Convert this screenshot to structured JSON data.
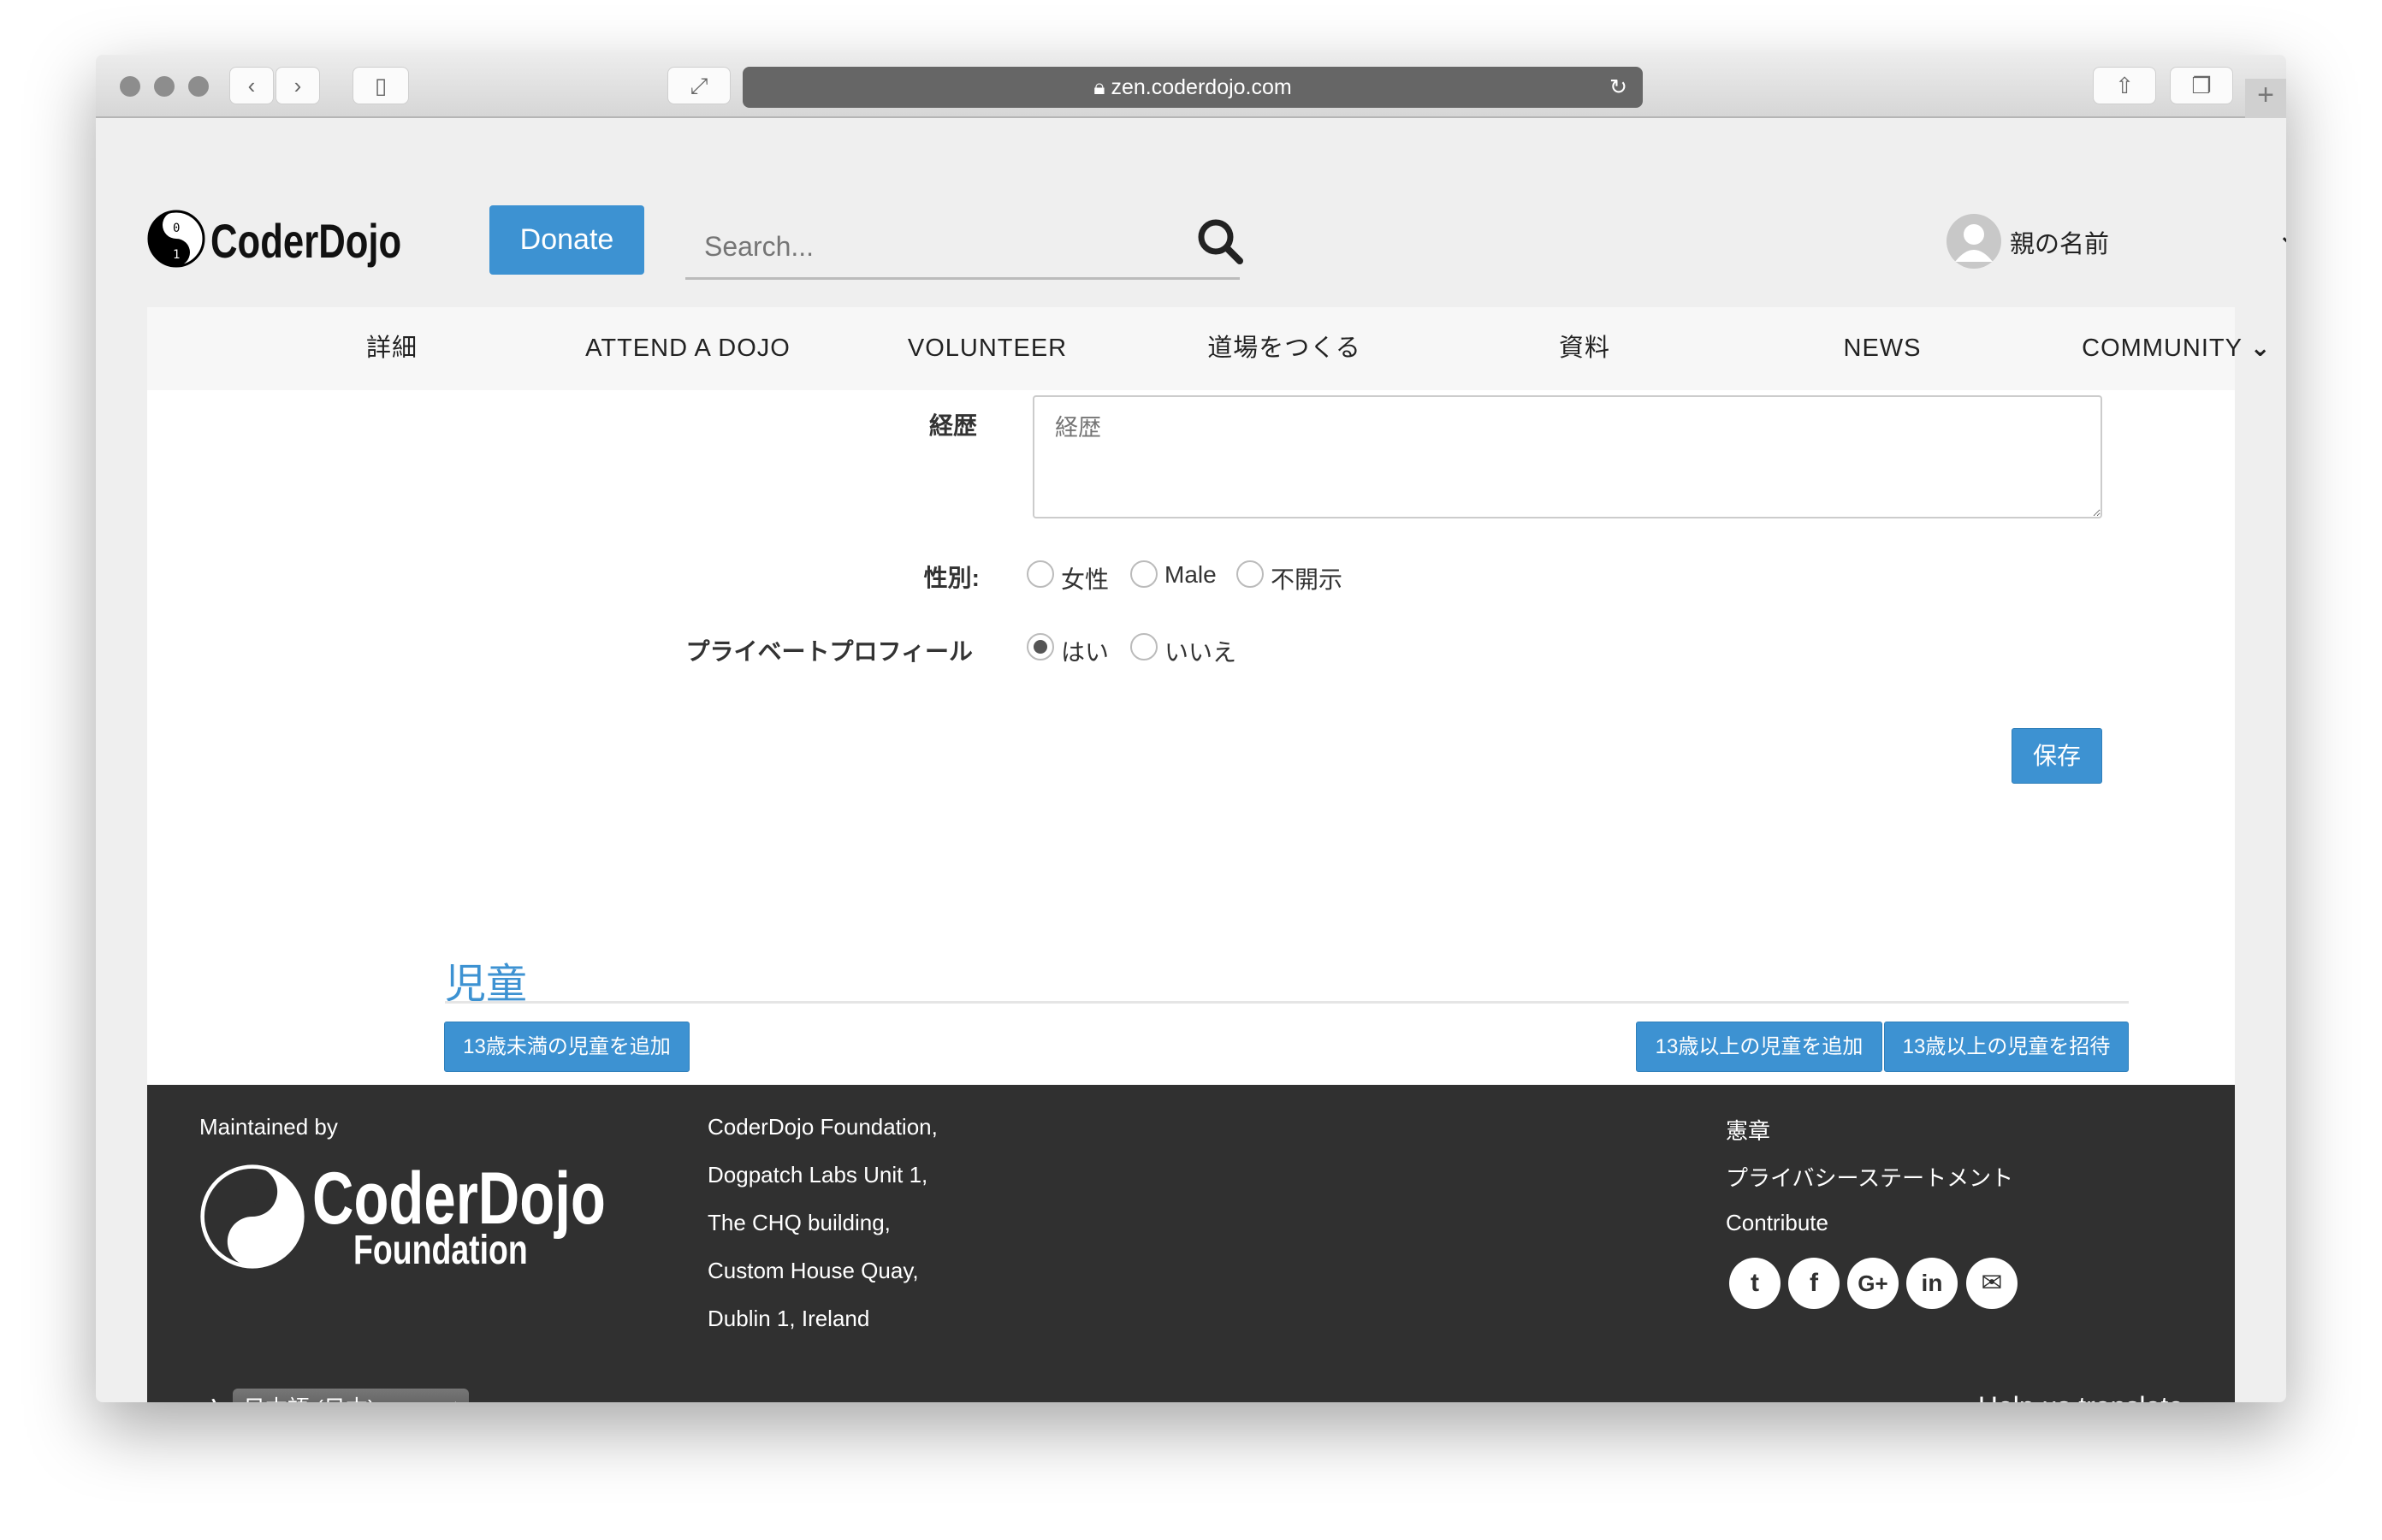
{
  "browser": {
    "url": "zen.coderdojo.com"
  },
  "header": {
    "logo": "CoderDojo",
    "donate": "Donate",
    "search_placeholder": "Search...",
    "user_name": "親の名前"
  },
  "nav": [
    "詳細",
    "ATTEND A DOJO",
    "VOLUNTEER",
    "道場をつくる",
    "資料",
    "NEWS",
    "COMMUNITY"
  ],
  "form": {
    "bio_label": "経歴",
    "bio_placeholder": "経歴",
    "gender_label": "性別:",
    "gender_options": [
      "女性",
      "Male",
      "不開示"
    ],
    "gender_selected": null,
    "private_label": "プライベートプロフィール",
    "private_options": [
      "はい",
      "いいえ"
    ],
    "private_selected": "はい",
    "save": "保存"
  },
  "children": {
    "heading": "児童",
    "add_under13": "13歳未満の児童を追加",
    "add_over13": "13歳以上の児童を追加",
    "invite_over13": "13歳以上の児童を招待"
  },
  "footer": {
    "maintained_by": "Maintained by",
    "logo_main": "CoderDojo",
    "logo_sub": "Foundation",
    "address": [
      "CoderDojo Foundation,",
      "Dogpatch Labs Unit 1,",
      "The CHQ building,",
      "Custom House Quay,",
      "Dublin 1, Ireland"
    ],
    "links": [
      "憲章",
      "プライバシーステートメント",
      "Contribute"
    ],
    "social": [
      "twitter",
      "facebook",
      "google-plus",
      "linkedin",
      "email"
    ],
    "language": "日本語 (日本)",
    "help_translate": "Help us translate"
  },
  "colors": {
    "accent": "#3d92d2",
    "footer_bg": "#303030"
  }
}
